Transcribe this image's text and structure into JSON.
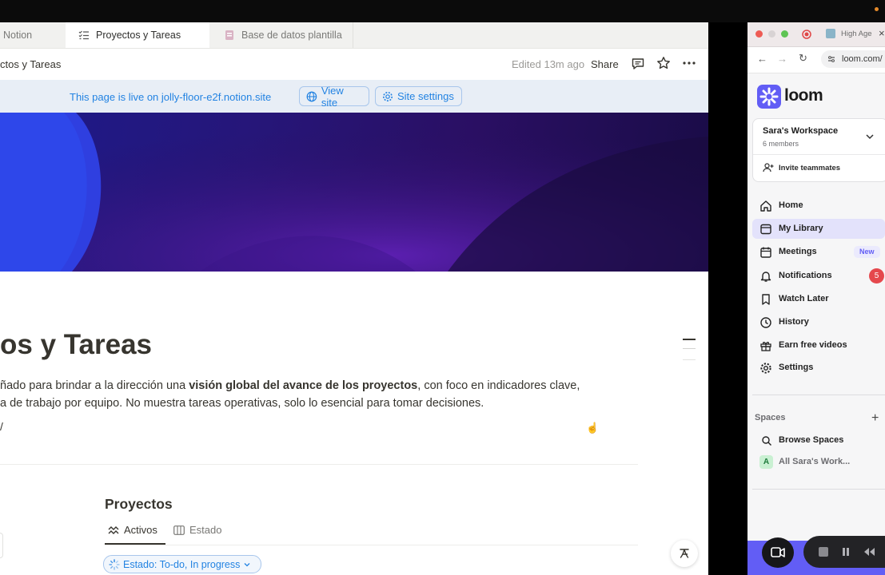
{
  "notion": {
    "tabs": [
      {
        "label": "Notion"
      },
      {
        "label": "Proyectos y Tareas"
      },
      {
        "label": "Base de datos plantilla"
      }
    ],
    "breadcrumb": "ctos y Tareas",
    "edited": "Edited 13m ago",
    "share_label": "Share",
    "live_banner": {
      "text": "This page is live on jolly-floor-e2f.notion.site",
      "view_site": "View site",
      "site_settings": "Site settings"
    },
    "title": "os y Tareas",
    "description": {
      "line1_a": "ñado para brindar a la dirección una ",
      "line1_bold": "visión global del avance de los proyectos",
      "line1_b": ", con foco en indicadores clave,",
      "line2": "a de trabajo por equipo. No muestra tareas operativas, solo lo esencial para tomar decisiones."
    },
    "slash_text": "/",
    "database": {
      "title": "Proyectos",
      "views": [
        {
          "label": "Activos",
          "icon": "chart-icon",
          "active": true
        },
        {
          "label": "Estado",
          "icon": "board-icon",
          "active": false
        }
      ],
      "filter": "Estado: To-do, In progress"
    }
  },
  "loom": {
    "browser_tab": "High Age",
    "url": "loom.com/",
    "brand": "loom",
    "accent": "#625df5",
    "workspace": {
      "name": "Sara's Workspace",
      "members": "6 members",
      "invite": "Invite teammates"
    },
    "nav": [
      {
        "label": "Home",
        "icon": "home-icon"
      },
      {
        "label": "My Library",
        "icon": "library-icon",
        "selected": true
      },
      {
        "label": "Meetings",
        "icon": "calendar-icon",
        "badge": "New"
      },
      {
        "label": "Notifications",
        "icon": "bell-icon",
        "count": "5"
      },
      {
        "label": "Watch Later",
        "icon": "bookmark-icon"
      },
      {
        "label": "History",
        "icon": "clock-icon"
      },
      {
        "label": "Earn free videos",
        "icon": "gift-icon"
      },
      {
        "label": "Settings",
        "icon": "gear-icon"
      }
    ],
    "spaces_label": "Spaces",
    "spaces": [
      {
        "label": "Browse Spaces",
        "icon": "search-icon"
      },
      {
        "label": "All Sara's Work...",
        "avatar": "A"
      }
    ]
  }
}
